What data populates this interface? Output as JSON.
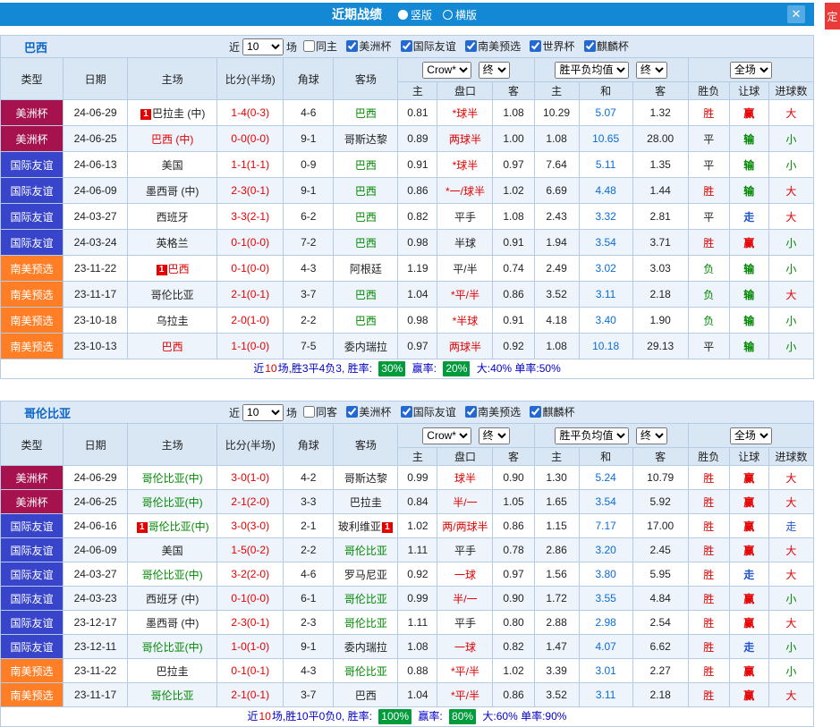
{
  "titlebar": {
    "title": "近期战绩",
    "radios": [
      {
        "label": "竖版",
        "state_class": "on"
      },
      {
        "label": "横版",
        "state_class": "off"
      }
    ],
    "close": "✕",
    "side_tab": "定"
  },
  "columns": {
    "type": "类型",
    "date": "日期",
    "home": "主场",
    "score": "比分(半场)",
    "corner": "角球",
    "away": "客场",
    "h": "主",
    "handicap": "盘口",
    "a": "客",
    "h2": "主",
    "draw": "和",
    "a2": "客",
    "result": "胜负",
    "hcp_result": "让球",
    "goals": "进球数"
  },
  "sections": [
    {
      "name": "巴西",
      "filter": {
        "prefix": "近",
        "count": "10",
        "suffix": "场",
        "checks": [
          {
            "label": "同主",
            "checked": false
          },
          {
            "label": "美洲杯",
            "checked": true
          },
          {
            "label": "国际友谊",
            "checked": true
          },
          {
            "label": "南美预选",
            "checked": true
          },
          {
            "label": "世界杯",
            "checked": true
          },
          {
            "label": "麒麟杯",
            "checked": true
          }
        ]
      },
      "selects": {
        "book": "Crow*",
        "final1": "终",
        "avg": "胜平负均值",
        "final2": "终",
        "scope": "全场"
      },
      "rows": [
        {
          "type": "美洲杯",
          "type_class": "t-cup",
          "date": "24-06-29",
          "home_badge": "1",
          "home": "巴拉圭 (中)",
          "home_class": "c-black",
          "score": "1-4(0-3)",
          "corner": "4-6",
          "away": "巴西",
          "away_class": "c-green",
          "oh": "0.81",
          "hcap": "*球半",
          "hcap_class": "c-red",
          "oa": "1.08",
          "eh": "10.29",
          "ed": "5.07",
          "ea": "1.32",
          "r1": "胜",
          "r1c": "c-red",
          "r2": "赢",
          "r2c": "c-red",
          "r3": "大",
          "r3c": "c-red"
        },
        {
          "type": "美洲杯",
          "type_class": "t-cup",
          "date": "24-06-25",
          "home": "巴西 (中)",
          "home_class": "c-red",
          "score": "0-0(0-0)",
          "corner": "9-1",
          "away": "哥斯达黎",
          "away_class": "c-black",
          "oh": "0.89",
          "hcap": "两球半",
          "hcap_class": "c-red",
          "oa": "1.00",
          "eh": "1.08",
          "ed": "10.65",
          "ea": "28.00",
          "r1": "平",
          "r1c": "c-black",
          "r2": "输",
          "r2c": "c-green",
          "r3": "小",
          "r3c": "c-green"
        },
        {
          "type": "国际友谊",
          "type_class": "t-fr",
          "date": "24-06-13",
          "home": "美国",
          "home_class": "c-black",
          "score": "1-1(1-1)",
          "corner": "0-9",
          "away": "巴西",
          "away_class": "c-green",
          "oh": "0.91",
          "hcap": "*球半",
          "hcap_class": "c-red",
          "oa": "0.97",
          "eh": "7.64",
          "ed": "5.11",
          "ea": "1.35",
          "r1": "平",
          "r1c": "c-black",
          "r2": "输",
          "r2c": "c-green",
          "r3": "小",
          "r3c": "c-green"
        },
        {
          "type": "国际友谊",
          "type_class": "t-fr",
          "date": "24-06-09",
          "home": "墨西哥 (中)",
          "home_class": "c-black",
          "score": "2-3(0-1)",
          "corner": "9-1",
          "away": "巴西",
          "away_class": "c-green",
          "oh": "0.86",
          "hcap": "*一/球半",
          "hcap_class": "c-red",
          "oa": "1.02",
          "eh": "6.69",
          "ed": "4.48",
          "ea": "1.44",
          "r1": "胜",
          "r1c": "c-red",
          "r2": "输",
          "r2c": "c-green",
          "r3": "大",
          "r3c": "c-red"
        },
        {
          "type": "国际友谊",
          "type_class": "t-fr",
          "date": "24-03-27",
          "home": "西班牙",
          "home_class": "c-black",
          "score": "3-3(2-1)",
          "corner": "6-2",
          "away": "巴西",
          "away_class": "c-green",
          "oh": "0.82",
          "hcap": "平手",
          "hcap_class": "c-black",
          "oa": "1.08",
          "eh": "2.43",
          "ed": "3.32",
          "ea": "2.81",
          "r1": "平",
          "r1c": "c-black",
          "r2": "走",
          "r2c": "c-blue",
          "r3": "大",
          "r3c": "c-red"
        },
        {
          "type": "国际友谊",
          "type_class": "t-fr",
          "date": "24-03-24",
          "home": "英格兰",
          "home_class": "c-black",
          "score": "0-1(0-0)",
          "corner": "7-2",
          "away": "巴西",
          "away_class": "c-green",
          "oh": "0.98",
          "hcap": "半球",
          "hcap_class": "c-black",
          "oa": "0.91",
          "eh": "1.94",
          "ed": "3.54",
          "ea": "3.71",
          "r1": "胜",
          "r1c": "c-red",
          "r2": "赢",
          "r2c": "c-red",
          "r3": "小",
          "r3c": "c-green"
        },
        {
          "type": "南美预选",
          "type_class": "t-wcq",
          "date": "23-11-22",
          "home_badge": "1",
          "home": "巴西",
          "home_class": "c-red",
          "score": "0-1(0-0)",
          "corner": "4-3",
          "away": "阿根廷",
          "away_class": "c-black",
          "oh": "1.19",
          "hcap": "平/半",
          "hcap_class": "c-black",
          "oa": "0.74",
          "eh": "2.49",
          "ed": "3.02",
          "ea": "3.03",
          "r1": "负",
          "r1c": "c-green",
          "r2": "输",
          "r2c": "c-green",
          "r3": "小",
          "r3c": "c-green"
        },
        {
          "type": "南美预选",
          "type_class": "t-wcq",
          "date": "23-11-17",
          "home": "哥伦比亚",
          "home_class": "c-black",
          "score": "2-1(0-1)",
          "corner": "3-7",
          "away": "巴西",
          "away_class": "c-green",
          "oh": "1.04",
          "hcap": "*平/半",
          "hcap_class": "c-red",
          "oa": "0.86",
          "eh": "3.52",
          "ed": "3.11",
          "ea": "2.18",
          "r1": "负",
          "r1c": "c-green",
          "r2": "输",
          "r2c": "c-green",
          "r3": "大",
          "r3c": "c-red"
        },
        {
          "type": "南美预选",
          "type_class": "t-wcq",
          "date": "23-10-18",
          "home": "乌拉圭",
          "home_class": "c-black",
          "score": "2-0(1-0)",
          "corner": "2-2",
          "away": "巴西",
          "away_class": "c-green",
          "oh": "0.98",
          "hcap": "*半球",
          "hcap_class": "c-red",
          "oa": "0.91",
          "eh": "4.18",
          "ed": "3.40",
          "ea": "1.90",
          "r1": "负",
          "r1c": "c-green",
          "r2": "输",
          "r2c": "c-green",
          "r3": "小",
          "r3c": "c-green"
        },
        {
          "type": "南美预选",
          "type_class": "t-wcq",
          "date": "23-10-13",
          "home": "巴西",
          "home_class": "c-red",
          "score": "1-1(0-0)",
          "corner": "7-5",
          "away": "委内瑞拉",
          "away_class": "c-black",
          "oh": "0.97",
          "hcap": "两球半",
          "hcap_class": "c-red",
          "oa": "0.92",
          "eh": "1.08",
          "ed": "10.18",
          "ea": "29.13",
          "r1": "平",
          "r1c": "c-black",
          "r2": "输",
          "r2c": "c-green",
          "r3": "小",
          "r3c": "c-green"
        }
      ],
      "footer": {
        "pre": "近",
        "n": "10",
        "mid": "场,胜3平4负3, 胜率:",
        "rate1": "30%",
        "l2": "赢率:",
        "rate2": "20%",
        "tail": "大:40% 单率:50%"
      }
    },
    {
      "name": "哥伦比亚",
      "filter": {
        "prefix": "近",
        "count": "10",
        "suffix": "场",
        "checks": [
          {
            "label": "同客",
            "checked": false
          },
          {
            "label": "美洲杯",
            "checked": true
          },
          {
            "label": "国际友谊",
            "checked": true
          },
          {
            "label": "南美预选",
            "checked": true
          },
          {
            "label": "麒麟杯",
            "checked": true
          }
        ]
      },
      "selects": {
        "book": "Crow*",
        "final1": "终",
        "avg": "胜平负均值",
        "final2": "终",
        "scope": "全场"
      },
      "rows": [
        {
          "type": "美洲杯",
          "type_class": "t-cup",
          "date": "24-06-29",
          "home": "哥伦比亚(中)",
          "home_class": "c-green",
          "score": "3-0(1-0)",
          "corner": "4-2",
          "away": "哥斯达黎",
          "away_class": "c-black",
          "oh": "0.99",
          "hcap": "球半",
          "hcap_class": "c-red",
          "oa": "0.90",
          "eh": "1.30",
          "ed": "5.24",
          "ea": "10.79",
          "r1": "胜",
          "r1c": "c-red",
          "r2": "赢",
          "r2c": "c-red",
          "r3": "大",
          "r3c": "c-red"
        },
        {
          "type": "美洲杯",
          "type_class": "t-cup",
          "date": "24-06-25",
          "home": "哥伦比亚(中)",
          "home_class": "c-green",
          "score": "2-1(2-0)",
          "corner": "3-3",
          "away": "巴拉圭",
          "away_class": "c-black",
          "oh": "0.84",
          "hcap": "半/一",
          "hcap_class": "c-red",
          "oa": "1.05",
          "eh": "1.65",
          "ed": "3.54",
          "ea": "5.92",
          "r1": "胜",
          "r1c": "c-red",
          "r2": "赢",
          "r2c": "c-red",
          "r3": "大",
          "r3c": "c-red"
        },
        {
          "type": "国际友谊",
          "type_class": "t-fr",
          "date": "24-06-16",
          "home_badge": "1",
          "home": "哥伦比亚(中)",
          "home_class": "c-green",
          "score": "3-0(3-0)",
          "corner": "2-1",
          "away": "玻利维亚",
          "away_badge": "1",
          "away_class": "c-black",
          "oh": "1.02",
          "hcap": "两/两球半",
          "hcap_class": "c-red",
          "oa": "0.86",
          "eh": "1.15",
          "ed": "7.17",
          "ea": "17.00",
          "r1": "胜",
          "r1c": "c-red",
          "r2": "赢",
          "r2c": "c-red",
          "r3": "走",
          "r3c": "c-blue"
        },
        {
          "type": "国际友谊",
          "type_class": "t-fr",
          "date": "24-06-09",
          "home": "美国",
          "home_class": "c-black",
          "score": "1-5(0-2)",
          "corner": "2-2",
          "away": "哥伦比亚",
          "away_class": "c-green",
          "oh": "1.11",
          "hcap": "平手",
          "hcap_class": "c-black",
          "oa": "0.78",
          "eh": "2.86",
          "ed": "3.20",
          "ea": "2.45",
          "r1": "胜",
          "r1c": "c-red",
          "r2": "赢",
          "r2c": "c-red",
          "r3": "大",
          "r3c": "c-red"
        },
        {
          "type": "国际友谊",
          "type_class": "t-fr",
          "date": "24-03-27",
          "home": "哥伦比亚(中)",
          "home_class": "c-green",
          "score": "3-2(2-0)",
          "corner": "4-6",
          "away": "罗马尼亚",
          "away_class": "c-black",
          "oh": "0.92",
          "hcap": "一球",
          "hcap_class": "c-red",
          "oa": "0.97",
          "eh": "1.56",
          "ed": "3.80",
          "ea": "5.95",
          "r1": "胜",
          "r1c": "c-red",
          "r2": "走",
          "r2c": "c-blue",
          "r3": "大",
          "r3c": "c-red"
        },
        {
          "type": "国际友谊",
          "type_class": "t-fr",
          "date": "24-03-23",
          "home": "西班牙 (中)",
          "home_class": "c-black",
          "score": "0-1(0-0)",
          "corner": "6-1",
          "away": "哥伦比亚",
          "away_class": "c-green",
          "oh": "0.99",
          "hcap": "半/一",
          "hcap_class": "c-red",
          "oa": "0.90",
          "eh": "1.72",
          "ed": "3.55",
          "ea": "4.84",
          "r1": "胜",
          "r1c": "c-red",
          "r2": "赢",
          "r2c": "c-red",
          "r3": "小",
          "r3c": "c-green"
        },
        {
          "type": "国际友谊",
          "type_class": "t-fr",
          "date": "23-12-17",
          "home": "墨西哥 (中)",
          "home_class": "c-black",
          "score": "2-3(0-1)",
          "corner": "2-3",
          "away": "哥伦比亚",
          "away_class": "c-green",
          "oh": "1.11",
          "hcap": "平手",
          "hcap_class": "c-black",
          "oa": "0.80",
          "eh": "2.88",
          "ed": "2.98",
          "ea": "2.54",
          "r1": "胜",
          "r1c": "c-red",
          "r2": "赢",
          "r2c": "c-red",
          "r3": "大",
          "r3c": "c-red"
        },
        {
          "type": "国际友谊",
          "type_class": "t-fr",
          "date": "23-12-11",
          "home": "哥伦比亚(中)",
          "home_class": "c-green",
          "score": "1-0(1-0)",
          "corner": "9-1",
          "away": "委内瑞拉",
          "away_class": "c-black",
          "oh": "1.08",
          "hcap": "一球",
          "hcap_class": "c-red",
          "oa": "0.82",
          "eh": "1.47",
          "ed": "4.07",
          "ea": "6.62",
          "r1": "胜",
          "r1c": "c-red",
          "r2": "走",
          "r2c": "c-blue",
          "r3": "小",
          "r3c": "c-green"
        },
        {
          "type": "南美预选",
          "type_class": "t-wcq",
          "date": "23-11-22",
          "home": "巴拉圭",
          "home_class": "c-black",
          "score": "0-1(0-1)",
          "corner": "4-3",
          "away": "哥伦比亚",
          "away_class": "c-green",
          "oh": "0.88",
          "hcap": "*平/半",
          "hcap_class": "c-red",
          "oa": "1.02",
          "eh": "3.39",
          "ed": "3.01",
          "ea": "2.27",
          "r1": "胜",
          "r1c": "c-red",
          "r2": "赢",
          "r2c": "c-red",
          "r3": "小",
          "r3c": "c-green"
        },
        {
          "type": "南美预选",
          "type_class": "t-wcq",
          "date": "23-11-17",
          "home": "哥伦比亚",
          "home_class": "c-green",
          "score": "2-1(0-1)",
          "corner": "3-7",
          "away": "巴西",
          "away_class": "c-black",
          "oh": "1.04",
          "hcap": "*平/半",
          "hcap_class": "c-red",
          "oa": "0.86",
          "eh": "3.52",
          "ed": "3.11",
          "ea": "2.18",
          "r1": "胜",
          "r1c": "c-red",
          "r2": "赢",
          "r2c": "c-red",
          "r3": "大",
          "r3c": "c-red"
        }
      ],
      "footer": {
        "pre": "近",
        "n": "10",
        "mid": "场,胜10平0负0, 胜率:",
        "rate1": "100%",
        "l2": "赢率:",
        "rate2": "80%",
        "tail": "大:60% 单率:90%"
      }
    }
  ]
}
